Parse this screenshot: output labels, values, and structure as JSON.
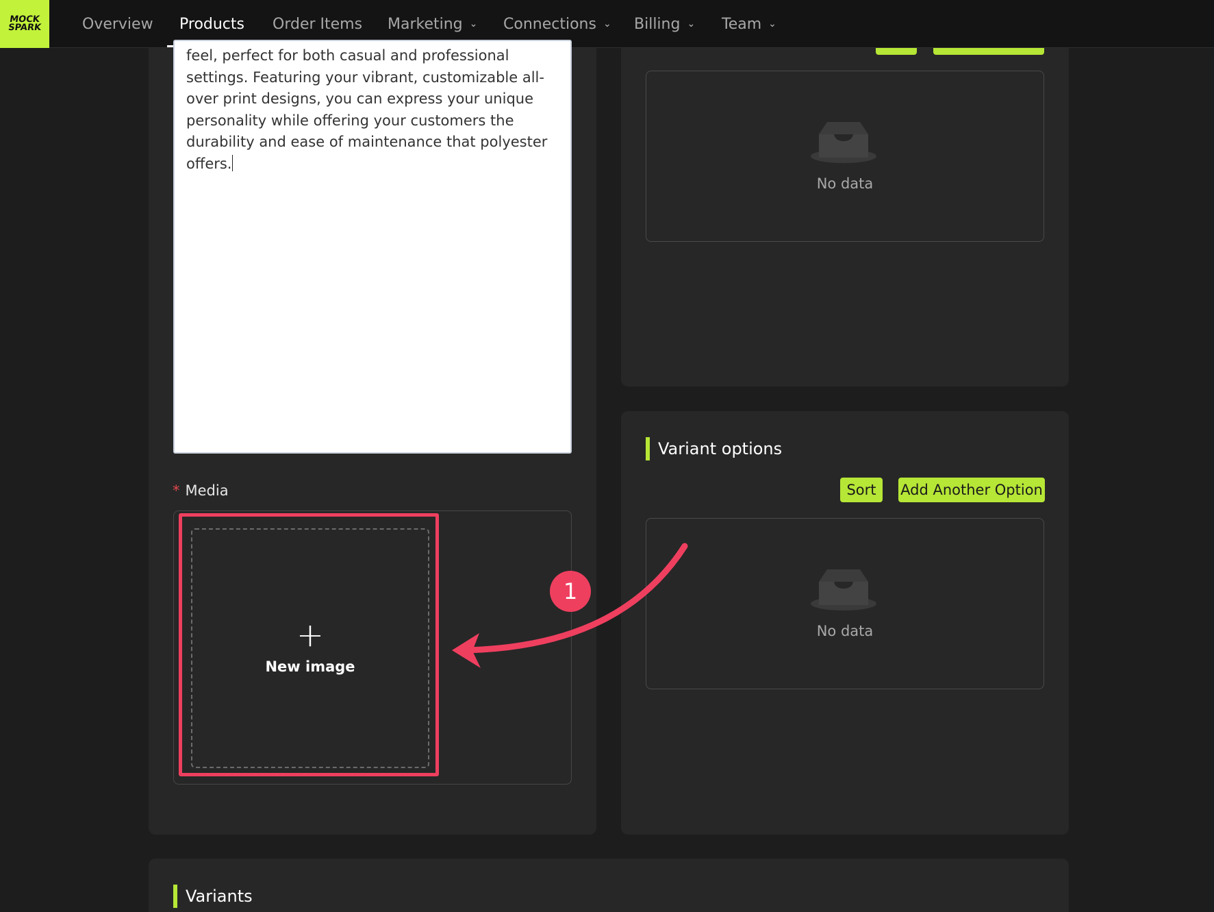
{
  "nav": {
    "logo_line1": "MOCK",
    "logo_line2": "SPARK",
    "items": [
      {
        "label": "Overview"
      },
      {
        "label": "Products"
      },
      {
        "label": "Order Items"
      },
      {
        "label": "Marketing"
      },
      {
        "label": "Connections"
      },
      {
        "label": "Billing"
      },
      {
        "label": "Team"
      }
    ]
  },
  "description": {
    "text": "feel, perfect for both casual and professional settings. Featuring your vibrant, customizable all-over print designs, you can express your unique personality while offering your customers the durability and ease of maintenance that polyester offers."
  },
  "media": {
    "required_mark": "*",
    "label": "Media",
    "upload_icon": "+",
    "upload_label": "New image"
  },
  "top_panel": {
    "empty_text": "No data"
  },
  "variant_options": {
    "title": "Variant options",
    "sort_label": "Sort",
    "add_label": "Add Another Option",
    "empty_text": "No data"
  },
  "variants": {
    "title": "Variants"
  },
  "annotation": {
    "step": "1",
    "color": "#ef3f5f"
  },
  "colors": {
    "accent": "#b6e636",
    "background": "#1d1d1d",
    "card": "#272727"
  }
}
